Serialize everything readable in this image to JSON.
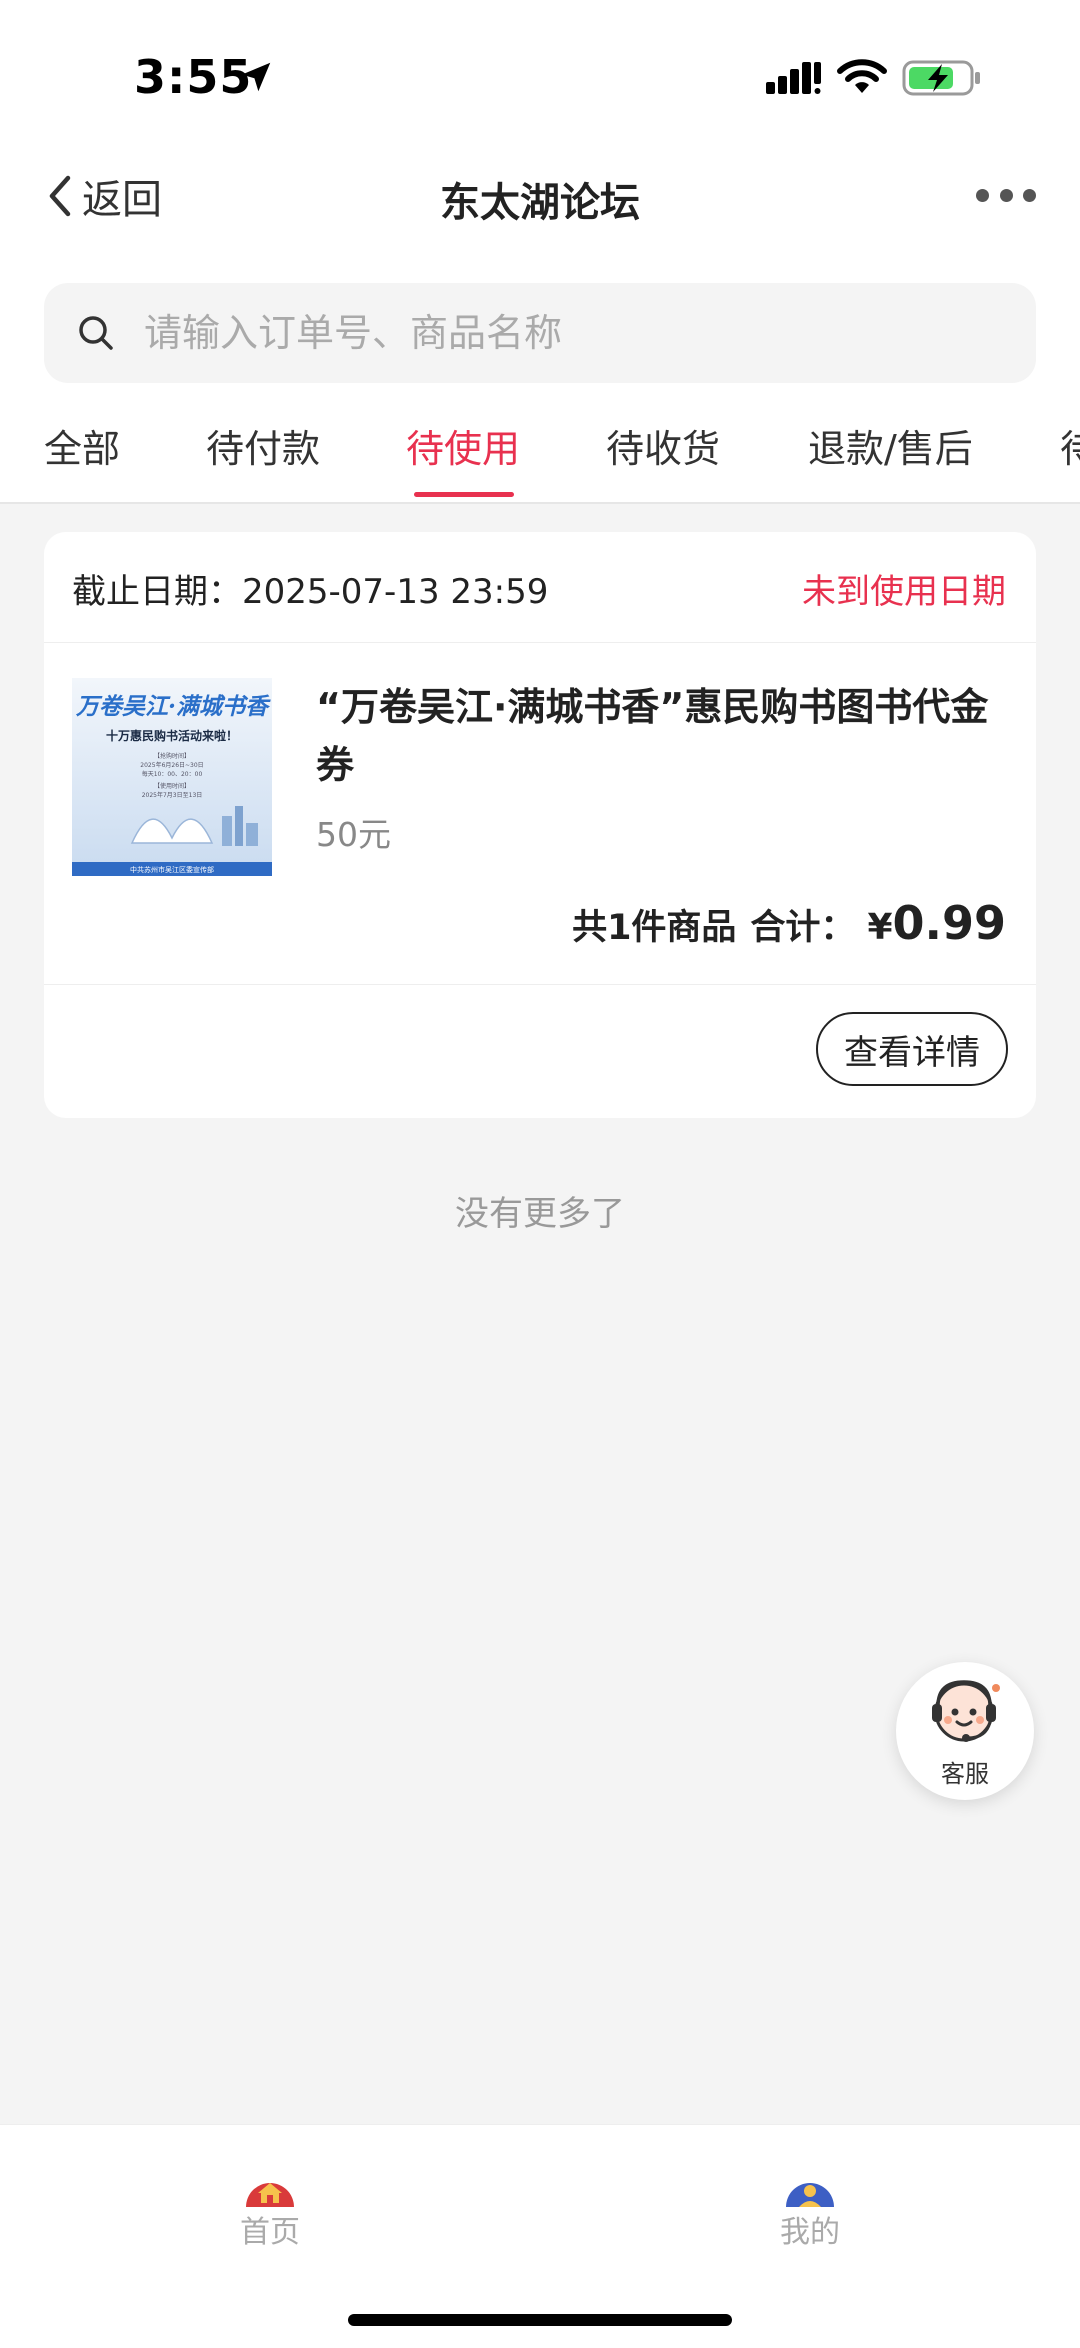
{
  "status_bar": {
    "time": "3:55"
  },
  "nav": {
    "back_label": "返回",
    "title": "东太湖论坛"
  },
  "search": {
    "placeholder": "请输入订单号、商品名称",
    "value": ""
  },
  "tabs": [
    {
      "label": "全部"
    },
    {
      "label": "待付款"
    },
    {
      "label": "待使用",
      "active": true
    },
    {
      "label": "待收货"
    },
    {
      "label": "退款/售后"
    },
    {
      "label": "待"
    }
  ],
  "order": {
    "deadline_text": "截止日期：2025-07-13 23:59",
    "status": "未到使用日期",
    "product": {
      "name": "“万卷吴江·满城书香”惠民购书图书代金券",
      "spec": "50元",
      "thumb_texts": {
        "title": "万卷吴江·满城书香",
        "subtitle": "十万惠民购书活动来啦！",
        "line1": "【抢购时间】",
        "line2": "2025年6月26日~30日",
        "line3": "每天10：00、20：00",
        "line4": "【使用时间】",
        "line5": "2025年7月3日至13日",
        "footer": "中共苏州市吴江区委宣传部"
      }
    },
    "summary": {
      "count_text": "共1件商品",
      "total_label": "合计：",
      "currency": "¥",
      "amount": "0.99"
    },
    "detail_button": "查看详情"
  },
  "list_end_text": "没有更多了",
  "service": {
    "label": "客服"
  },
  "tab_bar": {
    "home": "首页",
    "mine": "我的"
  },
  "colors": {
    "accent": "#e8314f",
    "page_bg": "#f4f4f4",
    "card_bg": "#ffffff"
  }
}
